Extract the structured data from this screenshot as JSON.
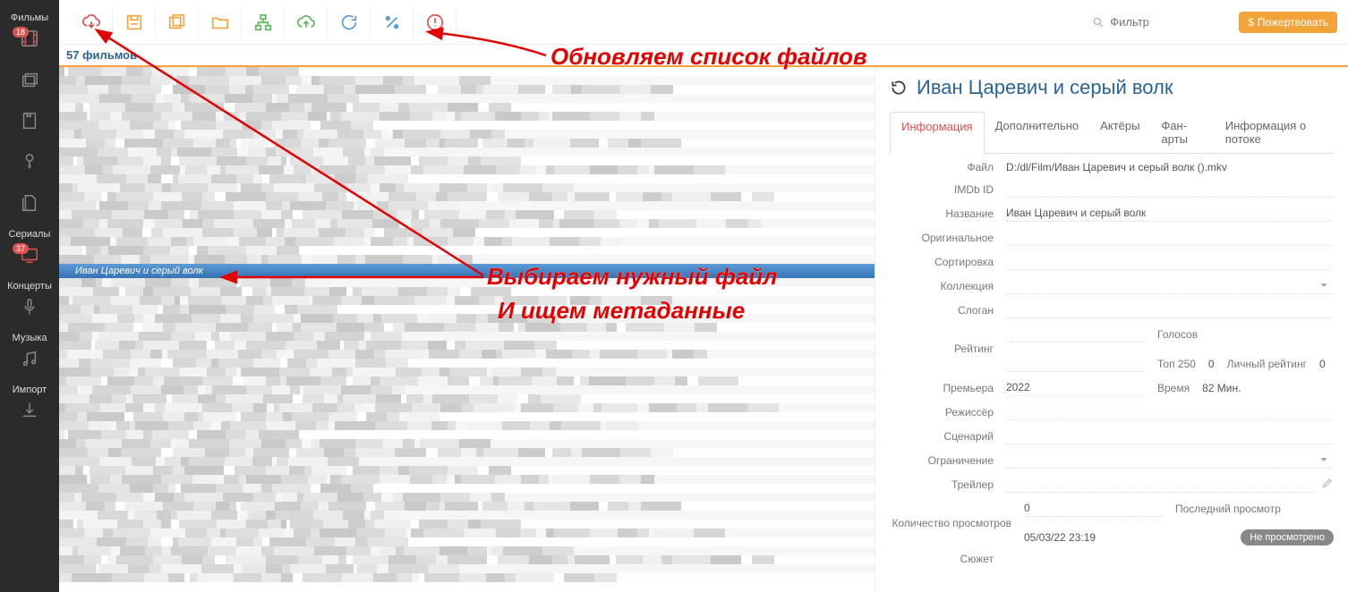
{
  "sidebar": {
    "items": [
      {
        "label": "Фильмы",
        "badge": "18"
      },
      {
        "label": ""
      },
      {
        "label": ""
      },
      {
        "label": ""
      },
      {
        "label": ""
      },
      {
        "label": "Сериалы",
        "badge": "37"
      },
      {
        "label": ""
      },
      {
        "label": "Концерты"
      },
      {
        "label": ""
      },
      {
        "label": "Музыка"
      },
      {
        "label": ""
      },
      {
        "label": "Импорт"
      },
      {
        "label": ""
      }
    ]
  },
  "toolbar": {
    "filter_placeholder": "Фильтр",
    "donate_label": "Пожертвовать"
  },
  "count_text": "57 фильмов",
  "list": {
    "selected_label": "Иван Царевич и серый волк"
  },
  "details": {
    "title": "Иван Царевич и серый волк",
    "tabs": [
      "Информация",
      "Дополнительно",
      "Актёры",
      "Фан-арты",
      "Информация о потоке"
    ],
    "fields": {
      "file_label": "Файл",
      "file_value": "D:/dl/Film/Иван Царевич и серый волк ().mkv",
      "imdb_label": "IMDb ID",
      "imdb_value": "",
      "name_label": "Название",
      "name_value": "Иван Царевич и серый волк",
      "original_label": "Оригинальное",
      "original_value": "",
      "sort_label": "Сортировка",
      "sort_value": "",
      "collection_label": "Коллекция",
      "collection_value": "",
      "slogan_label": "Слоган",
      "slogan_value": "",
      "rating_label": "Рейтинг",
      "rating_value": "",
      "votes_label": "Голосов",
      "votes_value": "",
      "top250_label": "Топ 250",
      "top250_value": "0",
      "personal_label": "Личный рейтинг",
      "personal_value": "0",
      "premiere_label": "Премьера",
      "premiere_value": "2022",
      "runtime_label": "Время",
      "runtime_value": "82 Мин.",
      "director_label": "Режиссёр",
      "director_value": "",
      "writer_label": "Сценарий",
      "writer_value": "",
      "cert_label": "Ограничение",
      "cert_value": "",
      "trailer_label": "Трейлер",
      "trailer_value": "",
      "views_label": "Количество просмотров",
      "views_value": "0",
      "lastview_label": "Последний просмотр",
      "lastview_value": "05/03/22 23:19",
      "watched_status": "Не просмотрено",
      "plot_label": "Сюжет",
      "plot_value": ""
    }
  },
  "annotations": {
    "a1": "Обновляем список файлов",
    "a2": "Выбираем нужный файл",
    "a3": "И ищем метаданные"
  }
}
